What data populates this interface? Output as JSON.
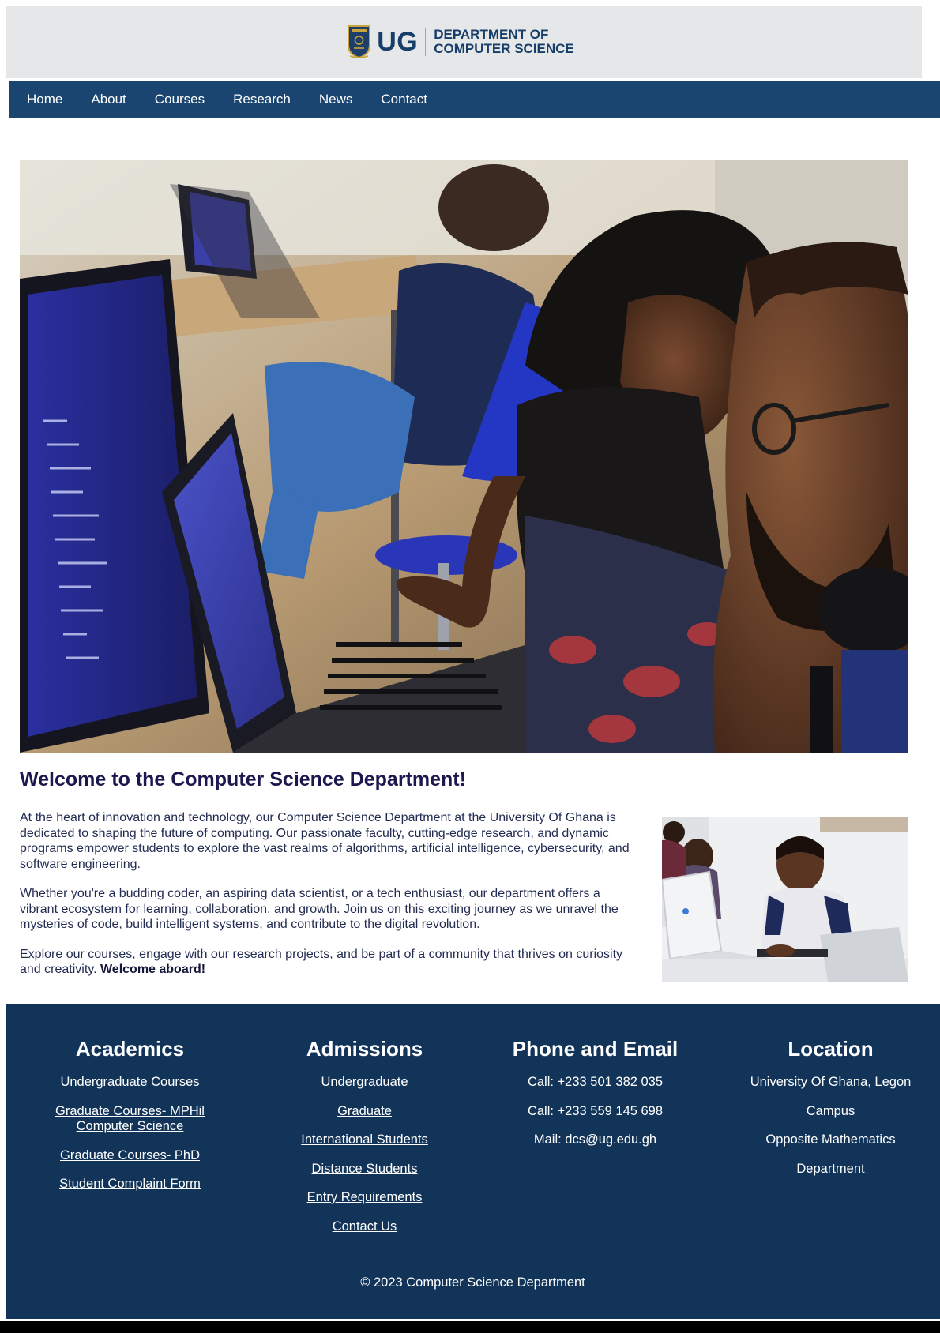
{
  "header": {
    "logo_text": "UG",
    "dept_line1": "DEPARTMENT OF",
    "dept_line2": "COMPUTER SCIENCE"
  },
  "nav": {
    "items": [
      "Home",
      "About",
      "Courses",
      "Research",
      "News",
      "Contact"
    ]
  },
  "welcome": {
    "title": "Welcome to the Computer Science Department!",
    "p1": "At the heart of innovation and technology, our Computer Science Department at the University Of Ghana is dedicated to shaping the future of computing. Our passionate faculty, cutting-edge research, and dynamic programs empower students to explore the vast realms of algorithms, artificial intelligence, cybersecurity, and software engineering.",
    "p2": "Whether you're a budding coder, an aspiring data scientist, or a tech enthusiast, our department offers a vibrant ecosystem for learning, collaboration, and growth. Join us on this exciting journey as we unravel the mysteries of code, build intelligent systems, and contribute to the digital revolution.",
    "p3": "Explore our courses, engage with our research projects, and be part of a community that thrives on curiosity and creativity.",
    "p3_bold": "Welcome aboard!"
  },
  "footer": {
    "academics": {
      "title": "Academics",
      "links": [
        "Undergraduate Courses",
        "Graduate Courses- MPHil Computer Science",
        "Graduate Courses- PhD",
        "Student Complaint Form"
      ]
    },
    "admissions": {
      "title": "Admissions",
      "links": [
        "Undergraduate",
        "Graduate",
        "International Students",
        "Distance Students",
        "Entry Requirements",
        "Contact Us"
      ]
    },
    "contact": {
      "title": "Phone and Email",
      "lines": [
        "Call: +233 501 382 035",
        "Call: +233 559 145 698",
        "Mail: dcs@ug.edu.gh"
      ]
    },
    "location": {
      "title": "Location",
      "lines": [
        "University Of Ghana, Legon",
        "Campus",
        "Opposite Mathematics",
        "Department"
      ]
    },
    "copyright": "© 2023 Computer Science Department"
  },
  "colors": {
    "nav_bg": "#194570",
    "header_bg": "#e6e7e9",
    "footer_bg": "#133459",
    "title_color": "#1b1850"
  }
}
